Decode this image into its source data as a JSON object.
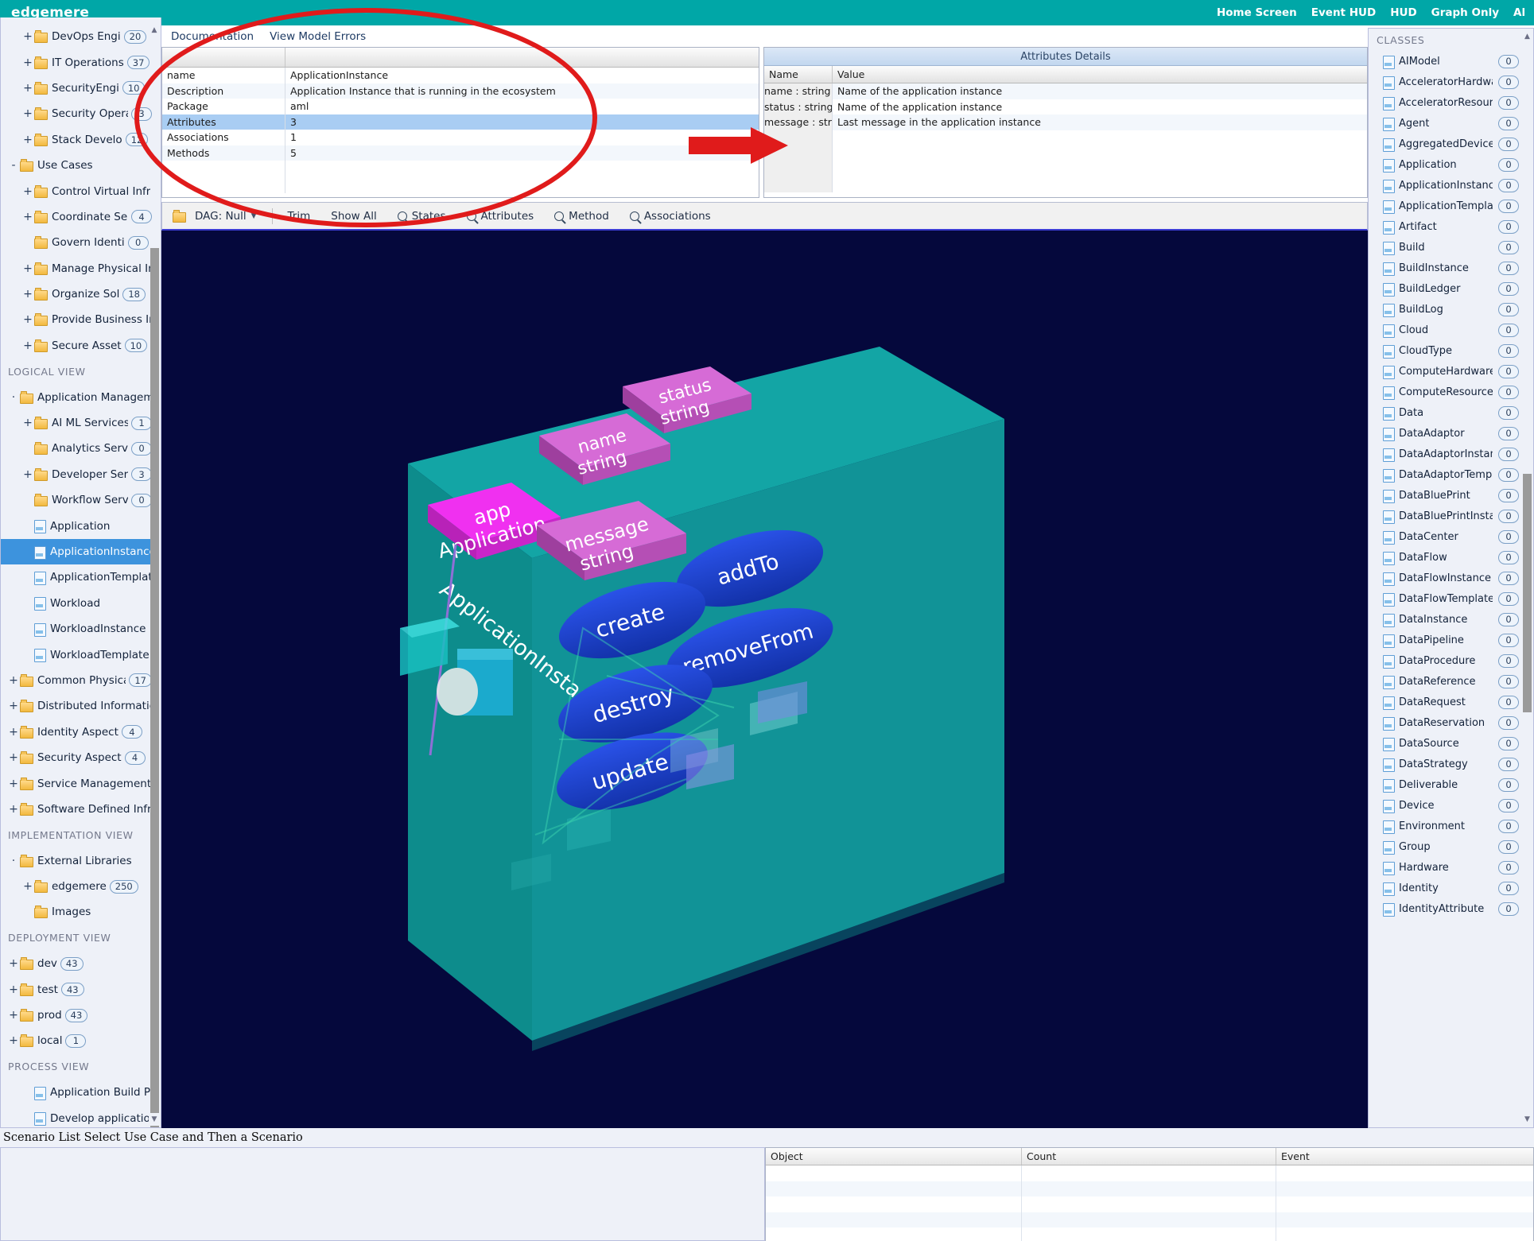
{
  "header": {
    "brand": "edgemere",
    "nav": [
      "Home Screen",
      "Event HUD",
      "HUD",
      "Graph Only",
      "All"
    ]
  },
  "tabs": {
    "documentation": "Documentation",
    "view_model_errors": "View Model Errors"
  },
  "detail_table": {
    "rows": [
      {
        "key": "name",
        "value": "ApplicationInstance",
        "highlight": false
      },
      {
        "key": "Description",
        "value": "Application Instance that is running in the ecosystem",
        "highlight": false
      },
      {
        "key": "Package",
        "value": "aml",
        "highlight": false
      },
      {
        "key": "Attributes",
        "value": "3",
        "highlight": true
      },
      {
        "key": "Associations",
        "value": "1",
        "highlight": false
      },
      {
        "key": "Methods",
        "value": "5",
        "highlight": false
      }
    ]
  },
  "attributes_details": {
    "title": "Attributes Details",
    "columns": {
      "name": "Name",
      "value": "Value"
    },
    "rows": [
      {
        "name": "name : string",
        "value": "Name of the application instance"
      },
      {
        "name": "status : string",
        "value": "Name of the application instance"
      },
      {
        "name": "message : stri...",
        "value": "Last message in the application instance"
      }
    ]
  },
  "toolbar": {
    "dag_label": "DAG: Null",
    "trim": "Trim",
    "show_all": "Show All",
    "states": "States",
    "attributes": "Attributes",
    "method": "Method",
    "associations": "Associations"
  },
  "graph": {
    "class_label": "ApplicationInstance",
    "association": {
      "label1": "app",
      "label2": "Application"
    },
    "attributes": [
      {
        "name": "name",
        "type": "string"
      },
      {
        "name": "status",
        "type": "string"
      },
      {
        "name": "message",
        "type": "string"
      }
    ],
    "methods": [
      "create",
      "addTo",
      "removeFrom",
      "destroy",
      "update"
    ],
    "colors": {
      "background": "#05083c",
      "class_box": "#0f9e9e",
      "attribute": "#d36bd3",
      "association": "#e81ee8",
      "method": "#1a3fd0"
    }
  },
  "sidebar": {
    "items": [
      {
        "label": "DevOps Engi",
        "type": "folder",
        "twisty": "+",
        "indent": 1,
        "badge": "20"
      },
      {
        "label": "IT Operations",
        "type": "folder",
        "twisty": "+",
        "indent": 1,
        "badge": "37"
      },
      {
        "label": "SecurityEngi",
        "type": "folder",
        "twisty": "+",
        "indent": 1,
        "badge": "10"
      },
      {
        "label": "Security Opera",
        "type": "folder",
        "twisty": "+",
        "indent": 1,
        "badge": "3"
      },
      {
        "label": "Stack Develo",
        "type": "folder",
        "twisty": "+",
        "indent": 1,
        "badge": "12"
      },
      {
        "label": "Use Cases",
        "type": "folder",
        "twisty": "-",
        "indent": 0,
        "badge": ""
      },
      {
        "label": "Control Virtual Infr",
        "type": "folder",
        "twisty": "+",
        "indent": 1,
        "badge": ""
      },
      {
        "label": "Coordinate Ser",
        "type": "folder",
        "twisty": "+",
        "indent": 1,
        "badge": "4"
      },
      {
        "label": "Govern Identi",
        "type": "folder",
        "twisty": "",
        "indent": 1,
        "badge": "0"
      },
      {
        "label": "Manage Physical In",
        "type": "folder",
        "twisty": "+",
        "indent": 1,
        "badge": ""
      },
      {
        "label": "Organize Sol",
        "type": "folder",
        "twisty": "+",
        "indent": 1,
        "badge": "18"
      },
      {
        "label": "Provide Business In",
        "type": "folder",
        "twisty": "+",
        "indent": 1,
        "badge": ""
      },
      {
        "label": "Secure Asset",
        "type": "folder",
        "twisty": "+",
        "indent": 1,
        "badge": "10"
      },
      {
        "label": "LOGICAL VIEW",
        "type": "group",
        "twisty": "",
        "indent": 0,
        "badge": ""
      },
      {
        "label": "Application Managem",
        "type": "folder",
        "twisty": "·",
        "indent": 0,
        "badge": ""
      },
      {
        "label": "AI ML Services",
        "type": "folder",
        "twisty": "+",
        "indent": 1,
        "badge": "1"
      },
      {
        "label": "Analytics Serv",
        "type": "folder",
        "twisty": "",
        "indent": 1,
        "badge": "0"
      },
      {
        "label": "Developer Ser",
        "type": "folder",
        "twisty": "+",
        "indent": 1,
        "badge": "3"
      },
      {
        "label": "Workflow Serv",
        "type": "folder",
        "twisty": "",
        "indent": 1,
        "badge": "0"
      },
      {
        "label": "Application",
        "type": "doc",
        "twisty": "",
        "indent": 1,
        "badge": ""
      },
      {
        "label": "ApplicationInstance",
        "type": "doc",
        "twisty": "",
        "indent": 1,
        "badge": "",
        "selected": true
      },
      {
        "label": "ApplicationTemplate",
        "type": "doc",
        "twisty": "",
        "indent": 1,
        "badge": ""
      },
      {
        "label": "Workload",
        "type": "doc",
        "twisty": "",
        "indent": 1,
        "badge": ""
      },
      {
        "label": "WorkloadInstance",
        "type": "doc",
        "twisty": "",
        "indent": 1,
        "badge": ""
      },
      {
        "label": "WorkloadTemplate",
        "type": "doc",
        "twisty": "",
        "indent": 1,
        "badge": ""
      },
      {
        "label": "Common Physical",
        "type": "folder",
        "twisty": "+",
        "indent": 0,
        "badge": "17"
      },
      {
        "label": "Distributed Informatio",
        "type": "folder",
        "twisty": "+",
        "indent": 0,
        "badge": ""
      },
      {
        "label": "Identity Aspect",
        "type": "folder",
        "twisty": "+",
        "indent": 0,
        "badge": "4"
      },
      {
        "label": "Security Aspect",
        "type": "folder",
        "twisty": "+",
        "indent": 0,
        "badge": "4"
      },
      {
        "label": "Service Management",
        "type": "folder",
        "twisty": "+",
        "indent": 0,
        "badge": ""
      },
      {
        "label": "Software Defined Infr",
        "type": "folder",
        "twisty": "+",
        "indent": 0,
        "badge": ""
      },
      {
        "label": "IMPLEMENTATION VIEW",
        "type": "group",
        "twisty": "",
        "indent": 0,
        "badge": ""
      },
      {
        "label": "External Libraries",
        "type": "folder",
        "twisty": "·",
        "indent": 0,
        "badge": ""
      },
      {
        "label": "edgemere",
        "type": "folder",
        "twisty": "+",
        "indent": 1,
        "badge": "250"
      },
      {
        "label": "Images",
        "type": "folder",
        "twisty": "",
        "indent": 1,
        "badge": ""
      },
      {
        "label": "DEPLOYMENT VIEW",
        "type": "group",
        "twisty": "",
        "indent": 0,
        "badge": ""
      },
      {
        "label": "dev",
        "type": "folder",
        "twisty": "+",
        "indent": 0,
        "badge": "43"
      },
      {
        "label": "test",
        "type": "folder",
        "twisty": "+",
        "indent": 0,
        "badge": "43"
      },
      {
        "label": "prod",
        "type": "folder",
        "twisty": "+",
        "indent": 0,
        "badge": "43"
      },
      {
        "label": "local",
        "type": "folder",
        "twisty": "+",
        "indent": 0,
        "badge": "1"
      },
      {
        "label": "PROCESS VIEW",
        "type": "group",
        "twisty": "",
        "indent": 0,
        "badge": ""
      },
      {
        "label": "Application Build Proc",
        "type": "doc",
        "twisty": "",
        "indent": 1,
        "badge": ""
      },
      {
        "label": "Develop application P",
        "type": "doc",
        "twisty": "",
        "indent": 1,
        "badge": ""
      }
    ]
  },
  "classes_panel": {
    "title": "CLASSES",
    "items": [
      {
        "label": "AIModel",
        "count": "0"
      },
      {
        "label": "AcceleratorHardware",
        "count": "0"
      },
      {
        "label": "AcceleratorResource",
        "count": "0"
      },
      {
        "label": "Agent",
        "count": "0"
      },
      {
        "label": "AggregatedDevice",
        "count": "0"
      },
      {
        "label": "Application",
        "count": "0"
      },
      {
        "label": "ApplicationInstance",
        "count": "0"
      },
      {
        "label": "ApplicationTemplate",
        "count": "0"
      },
      {
        "label": "Artifact",
        "count": "0"
      },
      {
        "label": "Build",
        "count": "0"
      },
      {
        "label": "BuildInstance",
        "count": "0"
      },
      {
        "label": "BuildLedger",
        "count": "0"
      },
      {
        "label": "BuildLog",
        "count": "0"
      },
      {
        "label": "Cloud",
        "count": "0"
      },
      {
        "label": "CloudType",
        "count": "0"
      },
      {
        "label": "ComputeHardware",
        "count": "0"
      },
      {
        "label": "ComputeResource",
        "count": "0"
      },
      {
        "label": "Data",
        "count": "0"
      },
      {
        "label": "DataAdaptor",
        "count": "0"
      },
      {
        "label": "DataAdaptorInstance",
        "count": "0"
      },
      {
        "label": "DataAdaptorTemplate",
        "count": "0"
      },
      {
        "label": "DataBluePrint",
        "count": "0"
      },
      {
        "label": "DataBluePrintInstance",
        "count": "0"
      },
      {
        "label": "DataCenter",
        "count": "0"
      },
      {
        "label": "DataFlow",
        "count": "0"
      },
      {
        "label": "DataFlowInstance",
        "count": "0"
      },
      {
        "label": "DataFlowTemplate",
        "count": "0"
      },
      {
        "label": "DataInstance",
        "count": "0"
      },
      {
        "label": "DataPipeline",
        "count": "0"
      },
      {
        "label": "DataProcedure",
        "count": "0"
      },
      {
        "label": "DataReference",
        "count": "0"
      },
      {
        "label": "DataRequest",
        "count": "0"
      },
      {
        "label": "DataReservation",
        "count": "0"
      },
      {
        "label": "DataSource",
        "count": "0"
      },
      {
        "label": "DataStrategy",
        "count": "0"
      },
      {
        "label": "Deliverable",
        "count": "0"
      },
      {
        "label": "Device",
        "count": "0"
      },
      {
        "label": "Environment",
        "count": "0"
      },
      {
        "label": "Group",
        "count": "0"
      },
      {
        "label": "Hardware",
        "count": "0"
      },
      {
        "label": "Identity",
        "count": "0"
      },
      {
        "label": "IdentityAttribute",
        "count": "0"
      }
    ]
  },
  "bottom": {
    "scenario_label": "Scenario List Select Use Case and Then a Scenario",
    "object_table": {
      "columns": [
        "Object",
        "Count",
        "Event"
      ],
      "rows": []
    }
  },
  "annotations": {
    "ellipse_color": "#e01b1b",
    "arrow_color": "#e01b1b"
  }
}
